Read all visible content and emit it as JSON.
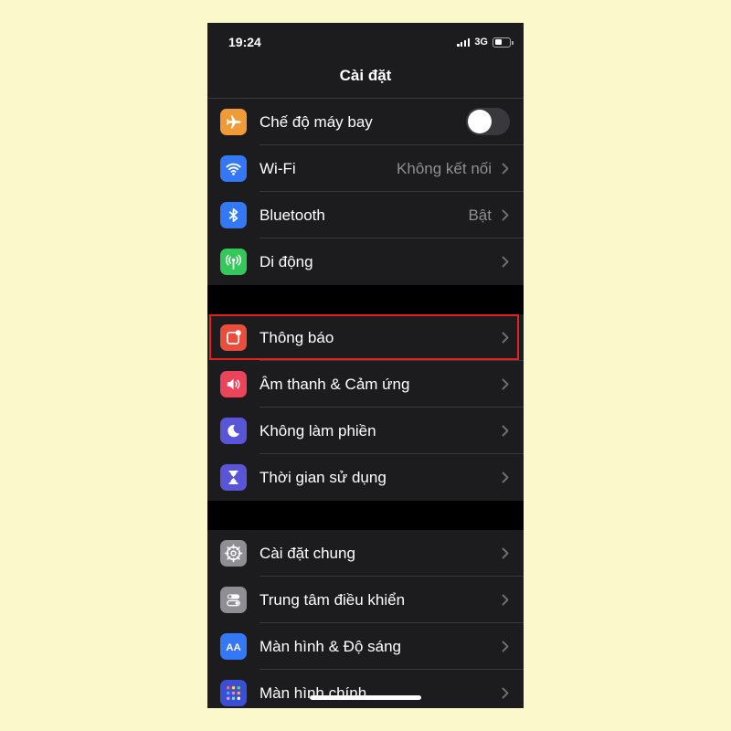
{
  "status_bar": {
    "time": "19:24",
    "network": "3G"
  },
  "nav": {
    "title": "Cài đặt"
  },
  "groups": [
    {
      "rows": [
        {
          "label": "Chế độ máy bay",
          "icon": "airplane-icon",
          "color": "#f19a38",
          "toggle": false
        },
        {
          "label": "Wi-Fi",
          "value": "Không kết nối",
          "icon": "wifi-icon",
          "color": "#3478f6"
        },
        {
          "label": "Bluetooth",
          "value": "Bật",
          "icon": "bluetooth-icon",
          "color": "#3478f6"
        },
        {
          "label": "Di động",
          "icon": "cellular-icon",
          "color": "#34c759"
        }
      ]
    },
    {
      "rows": [
        {
          "label": "Thông báo",
          "icon": "notifications-icon",
          "color": "#eb4d3d",
          "highlighted": true
        },
        {
          "label": "Âm thanh & Cảm ứng",
          "icon": "speaker-icon",
          "color": "#eb445a"
        },
        {
          "label": "Không làm phiền",
          "icon": "moon-icon",
          "color": "#5856d6"
        },
        {
          "label": "Thời gian sử dụng",
          "icon": "hourglass-icon",
          "color": "#5856d6"
        }
      ]
    },
    {
      "rows": [
        {
          "label": "Cài đặt chung",
          "icon": "gear-icon",
          "color": "#8e8e93"
        },
        {
          "label": "Trung tâm điều khiển",
          "icon": "control-center-icon",
          "color": "#8e8e93"
        },
        {
          "label": "Màn hình & Độ sáng",
          "icon": "display-brightness-icon",
          "color": "#3478f6"
        },
        {
          "label": "Màn hình chính",
          "icon": "home-screen-icon",
          "color": "#3a4fd6"
        }
      ]
    }
  ],
  "highlight_color": "#e0231f"
}
